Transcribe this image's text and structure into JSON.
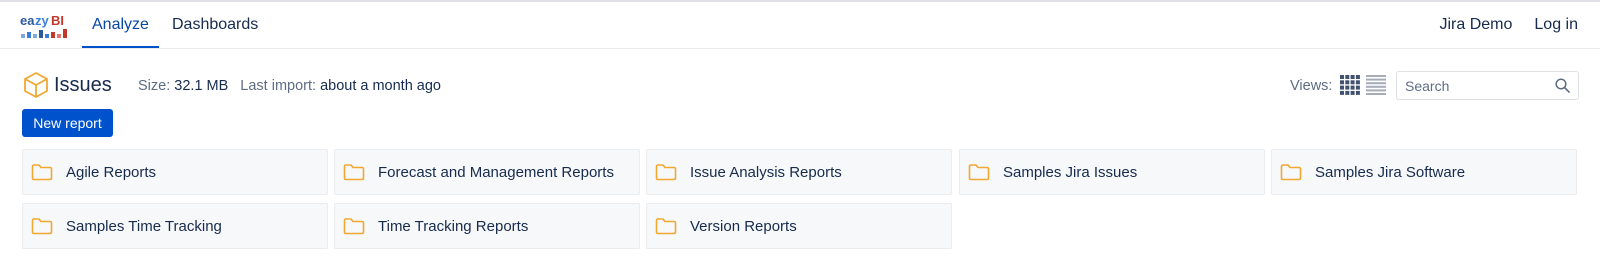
{
  "header": {
    "logo_text": "eazyBI",
    "nav": {
      "analyze": "Analyze",
      "dashboards": "Dashboards"
    },
    "account": {
      "site": "Jira Demo",
      "login": "Log in"
    }
  },
  "toolbar": {
    "title": "Issues",
    "size_label": "Size:",
    "size_value": "32.1 MB",
    "import_label": "Last import:",
    "import_value": "about a month ago",
    "views_label": "Views:",
    "search_placeholder": "Search",
    "new_report_label": "New report"
  },
  "colors": {
    "primary": "#0052cc",
    "folder": "#f0a833",
    "tile_bg": "#f7f8fa",
    "text": "#172b4d",
    "muted": "#5e6c84"
  },
  "icons": {
    "cube": "cube-icon",
    "folder": "folder-icon",
    "grid_view": "grid-view-icon",
    "list_view": "list-view-icon",
    "search": "search-icon"
  },
  "folders": [
    "Agile Reports",
    "Forecast and Management Reports",
    "Issue Analysis Reports",
    "Samples Jira Issues",
    "Samples Jira Software",
    "Samples Time Tracking",
    "Time Tracking Reports",
    "Version Reports"
  ]
}
